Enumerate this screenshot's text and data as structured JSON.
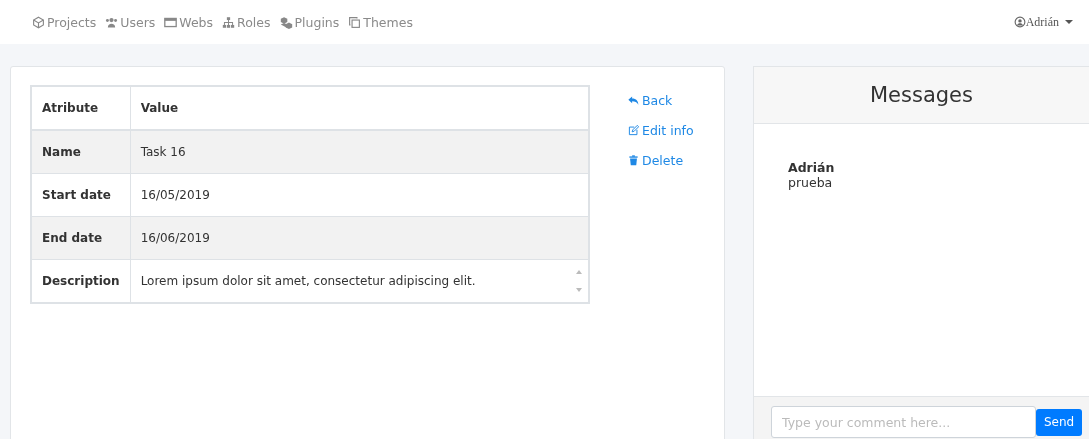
{
  "nav": {
    "items": [
      {
        "label": "Projects"
      },
      {
        "label": "Users"
      },
      {
        "label": "Webs"
      },
      {
        "label": "Roles"
      },
      {
        "label": "Plugins"
      },
      {
        "label": "Themes"
      }
    ],
    "user": "Adrián"
  },
  "table": {
    "columns": [
      "Atribute",
      "Value"
    ],
    "rows": [
      {
        "label": "Name",
        "value": "Task 16",
        "kind": "text"
      },
      {
        "label": "Start date",
        "value": "16/05/2019",
        "kind": "text"
      },
      {
        "label": "End date",
        "value": "16/06/2019",
        "kind": "text"
      },
      {
        "label": "Description",
        "value": "Lorem ipsum dolor sit amet, consectetur adipiscing elit.",
        "kind": "textarea"
      }
    ]
  },
  "actions": [
    {
      "label": "Back"
    },
    {
      "label": "Edit info"
    },
    {
      "label": "Delete"
    }
  ],
  "messages": {
    "title": "Messages",
    "items": [
      {
        "author": "Adrián",
        "text": "prueba"
      }
    ],
    "placeholder": "Type your comment here...",
    "send": "Send"
  }
}
